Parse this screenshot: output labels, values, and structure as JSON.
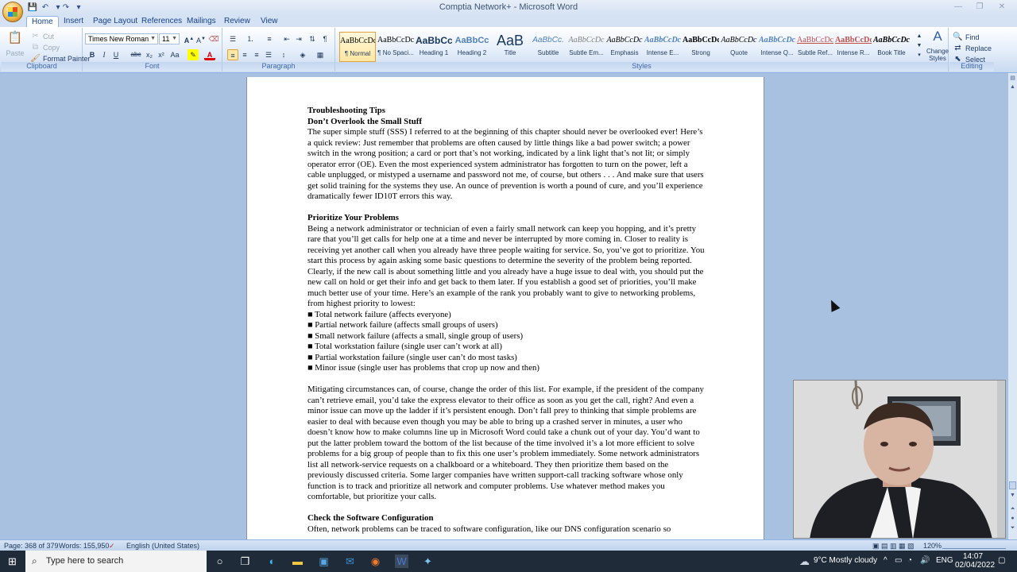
{
  "window": {
    "title": "Comptia Network+ - Microsoft Word"
  },
  "tabs": [
    "Home",
    "Insert",
    "Page Layout",
    "References",
    "Mailings",
    "Review",
    "View"
  ],
  "ribbon": {
    "clipboard": {
      "paste": "Paste",
      "cut": "Cut",
      "copy": "Copy",
      "format_painter": "Format Painter",
      "label": "Clipboard"
    },
    "font": {
      "family": "Times New Roman",
      "size": "11",
      "label": "Font",
      "bold": "B",
      "italic": "I",
      "underline": "U",
      "strike": "abc",
      "subscript": "x₂",
      "superscript": "x²",
      "change_case": "Aa",
      "font_color": "A"
    },
    "paragraph": {
      "label": "Paragraph"
    },
    "styles": {
      "label": "Styles",
      "items": [
        {
          "preview": "AaBbCcDc",
          "name": "¶ Normal"
        },
        {
          "preview": "AaBbCcDc",
          "name": "¶ No Spaci..."
        },
        {
          "preview": "AaBbCc",
          "name": "Heading 1"
        },
        {
          "preview": "AaBbCc",
          "name": "Heading 2"
        },
        {
          "preview": "AaB",
          "name": "Title"
        },
        {
          "preview": "AaBbCc.",
          "name": "Subtitle"
        },
        {
          "preview": "AaBbCcDc",
          "name": "Subtle Em..."
        },
        {
          "preview": "AaBbCcDc",
          "name": "Emphasis"
        },
        {
          "preview": "AaBbCcDc",
          "name": "Intense E..."
        },
        {
          "preview": "AaBbCcDc",
          "name": "Strong"
        },
        {
          "preview": "AaBbCcDc",
          "name": "Quote"
        },
        {
          "preview": "AaBbCcDc",
          "name": "Intense Q..."
        },
        {
          "preview": "AaBbCcDc",
          "name": "Subtle Ref..."
        },
        {
          "preview": "AaBbCcDc",
          "name": "Intense R..."
        },
        {
          "preview": "AaBbCcDc",
          "name": "Book Title"
        }
      ],
      "change_styles": "Change Styles"
    },
    "editing": {
      "label": "Editing",
      "find": "Find",
      "replace": "Replace",
      "select": "Select"
    }
  },
  "document": {
    "h1": "Troubleshooting Tips",
    "h2": "Don’t Overlook the Small Stuff",
    "p1": "The super simple stuff (SSS) I referred to at the beginning of this chapter should never be overlooked ever! Here’s a quick review: Just remember that problems are often caused by little things like a bad power switch; a power switch in the wrong position; a card or port that’s not working, indicated by a link light that’s not lit; or simply operator error (OE). Even the most experienced system administrator has forgotten to turn on the power, left a cable unplugged, or mistyped a username and password not me, of course, but others . . . And make sure that users get solid training for the systems they use. An ounce of prevention is worth a pound of cure, and you’ll experience dramatically fewer ID10T errors this way.",
    "h3": "Prioritize Your Problems",
    "p2": "Being a network administrator or technician of even a fairly small network can keep you hopping, and it’s pretty rare that you’ll get calls for help one at a time and never be interrupted by more coming in. Closer to reality is receiving yet another call when you already have three people waiting for service. So, you’ve got to prioritize. You start this process by again asking some basic questions to determine the severity of the problem being reported. Clearly, if the new call is about something little and you already have a huge issue to deal with, you should put the new call on hold or get their info and get back to them later. If you establish a good set of priorities, you’ll make much better use of your time. Here’s an example of the rank you probably want to give to networking problems, from highest priority to lowest:",
    "list": [
      "■ Total network failure (affects everyone)",
      "■ Partial network failure (affects small groups of users)",
      "■ Small network failure (affects a small, single group of users)",
      "■ Total workstation failure (single user can’t work at all)",
      "■ Partial workstation failure (single user can’t do most tasks)",
      "■ Minor issue (single user has problems that crop up now and then)"
    ],
    "p3": "Mitigating circumstances can, of course, change the order of this list. For example, if the president of the company can’t retrieve email, you’d take the express elevator to their office as soon as you get the call, right? And even a minor issue can move up the ladder if it’s persistent enough. Don’t fall prey to thinking that simple problems are easier to deal with because even though you may be able to bring up a crashed server in minutes, a user who doesn’t know how to make columns line up in Microsoft Word could take a chunk out of your day. You’d want to put the latter problem toward the bottom of the list because of the time involved it’s a lot more efficient to solve problems for a big group of people than to fix this one user’s problem immediately. Some network administrators list all network-service requests on a chalkboard or a whiteboard. They then prioritize them based on the previously discussed criteria. Some larger companies have written support-call tracking software whose only function is to track and prioritize all network and computer problems. Use whatever method makes you comfortable, but prioritize your calls.",
    "h4": "Check the Software Configuration",
    "p4": "Often, network problems can be traced to software configuration, like our DNS configuration scenario so"
  },
  "statusbar": {
    "page": "Page: 368 of 379",
    "words": "Words: 155,950",
    "language": "English (United States)",
    "zoom": "120%"
  },
  "taskbar": {
    "search_placeholder": "Type here to search",
    "weather": "9°C  Mostly cloudy",
    "lang": "ENG",
    "time": "14:07",
    "date": "02/04/2022"
  }
}
